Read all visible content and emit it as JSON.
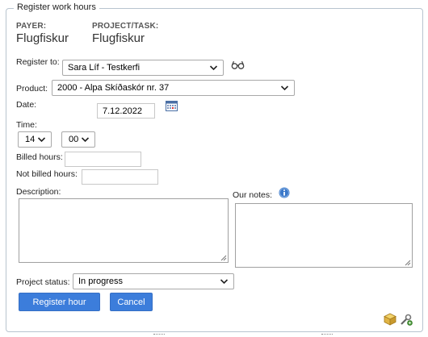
{
  "form": {
    "title": "Register work hours",
    "payer_label": "PAYER:",
    "payer_value": "Flugfiskur",
    "project_label": "PROJECT/TASK:",
    "project_value": "Flugfiskur",
    "register_to_label": "Register to:",
    "register_to_value": "Sara Líf - Testkerfi",
    "product_label": "Product:",
    "product_value": "2000 - Alpa Skíðaskór nr. 37",
    "date_label": "Date:",
    "date_value": "7.12.2022",
    "time_label": "Time:",
    "hour_value": "14",
    "minute_value": "00",
    "billed_hours_label": "Billed hours:",
    "billed_hours_value": "",
    "not_billed_hours_label": "Not billed hours:",
    "not_billed_hours_value": "",
    "description_label": "Description:",
    "our_notes_label": "Our notes:",
    "project_status_label": "Project status:",
    "project_status_value": "In progress",
    "register_button": "Register hour",
    "cancel_button": "Cancel"
  },
  "icons": {
    "lookup": "glasses-icon",
    "calendar": "calendar-icon",
    "info": "info-icon",
    "package": "package-icon",
    "tools": "tools-icon"
  },
  "colors": {
    "button_bg": "#3c7ddb",
    "frame_border": "#b8c4cf",
    "info_blue": "#3a78c9"
  }
}
